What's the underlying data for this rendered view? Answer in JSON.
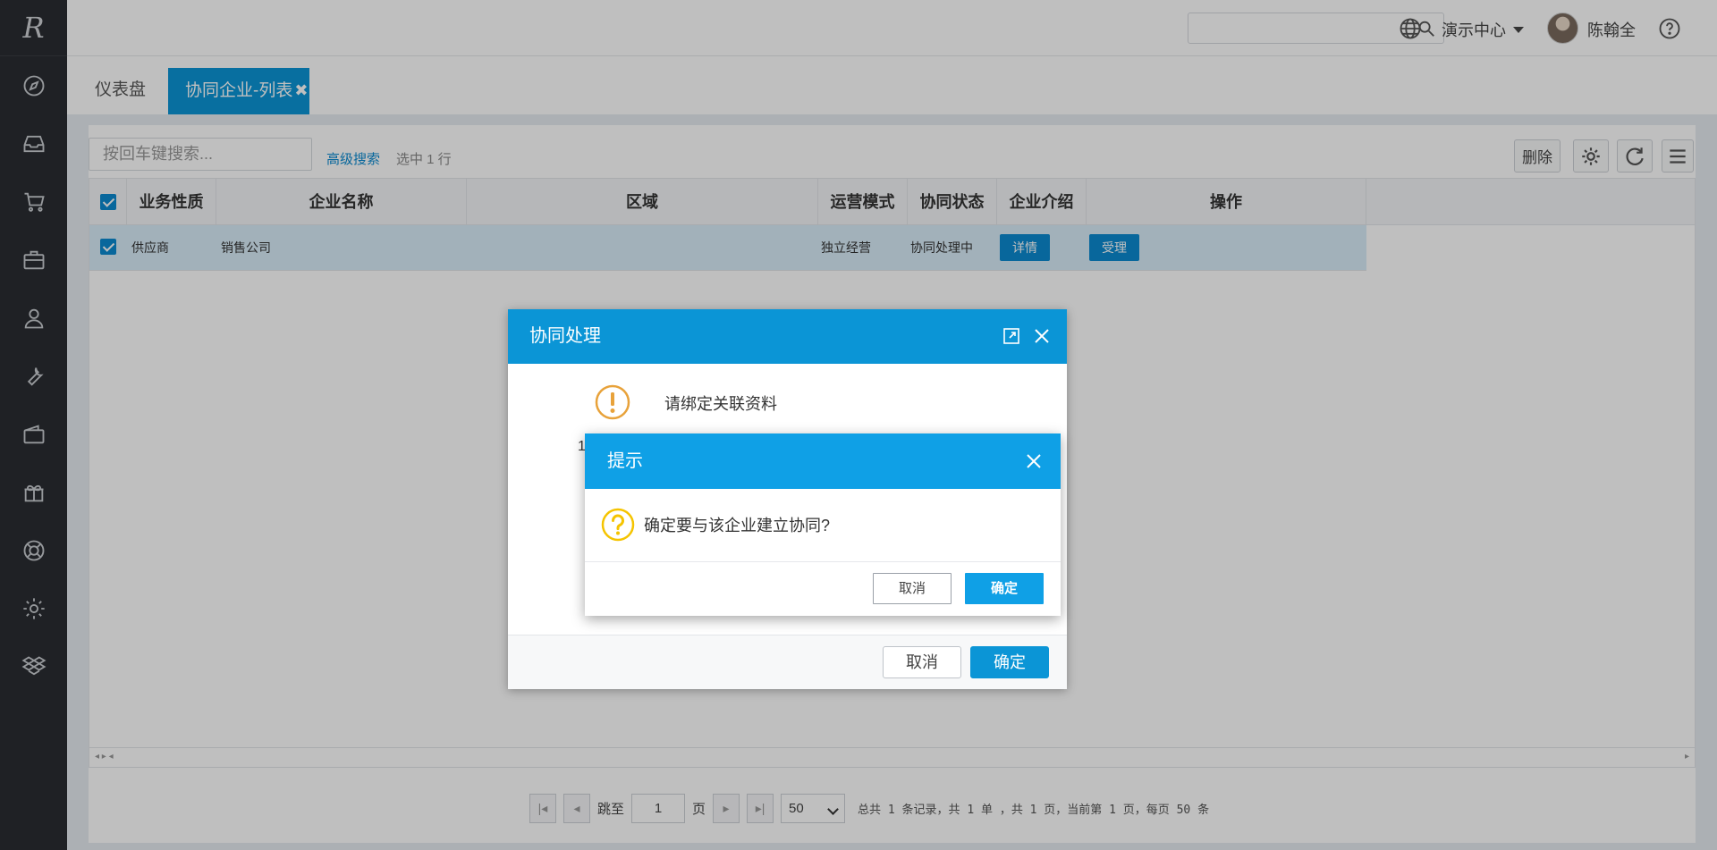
{
  "app": {
    "logo_text": "R"
  },
  "sidebar": {
    "items": [
      {
        "icon": "compass-icon"
      },
      {
        "icon": "inbox-icon"
      },
      {
        "icon": "cart-icon"
      },
      {
        "icon": "briefcase-icon"
      },
      {
        "icon": "user-icon"
      },
      {
        "icon": "wrench-icon"
      },
      {
        "icon": "wallet-icon"
      },
      {
        "icon": "gift-icon"
      },
      {
        "icon": "lifebuoy-icon"
      },
      {
        "icon": "gear-icon"
      },
      {
        "icon": "dropbox-icon"
      }
    ]
  },
  "header": {
    "search_value": "",
    "center_label": "演示中心",
    "user_name": "陈翰全"
  },
  "tabs": [
    {
      "label": "仪表盘",
      "active": false
    },
    {
      "label": "协同企业-列表",
      "active": true,
      "close": "✖"
    }
  ],
  "toolbar": {
    "keyword_placeholder": "按回车键搜索...",
    "advanced_search": "高级搜索",
    "selected_info": "选中 1 行",
    "delete_label": "删除"
  },
  "table": {
    "columns": [
      "业务性质",
      "企业名称",
      "区域",
      "运营模式",
      "协同状态",
      "企业介绍",
      "操作"
    ],
    "rows": [
      {
        "nature": "供应商",
        "name": "销售公司",
        "region": "",
        "mode": "独立经营",
        "status": "协同处理中",
        "intro_button": "详情",
        "action_button": "受理"
      }
    ]
  },
  "pager": {
    "goto_label": "跳至",
    "page_value": "1",
    "page_unit": "页",
    "page_size": "50",
    "summary": "总共 1 条记录，共 1 单 ，共 1 页，当前第 1 页，每页 50 条"
  },
  "dialog_process": {
    "title": "协同处理",
    "message": "请绑定关联资料",
    "stub_text": "1",
    "cancel_label": "取消",
    "ok_label": "确定"
  },
  "dialog_confirm": {
    "title": "提示",
    "message": "确定要与该企业建立协同?",
    "cancel_label": "取消",
    "ok_label": "确定"
  },
  "colors": {
    "sidebar_bg": "#2a2d32",
    "primary": "#0b95d6",
    "warning": "#e8a23a",
    "question": "#f5c400"
  }
}
